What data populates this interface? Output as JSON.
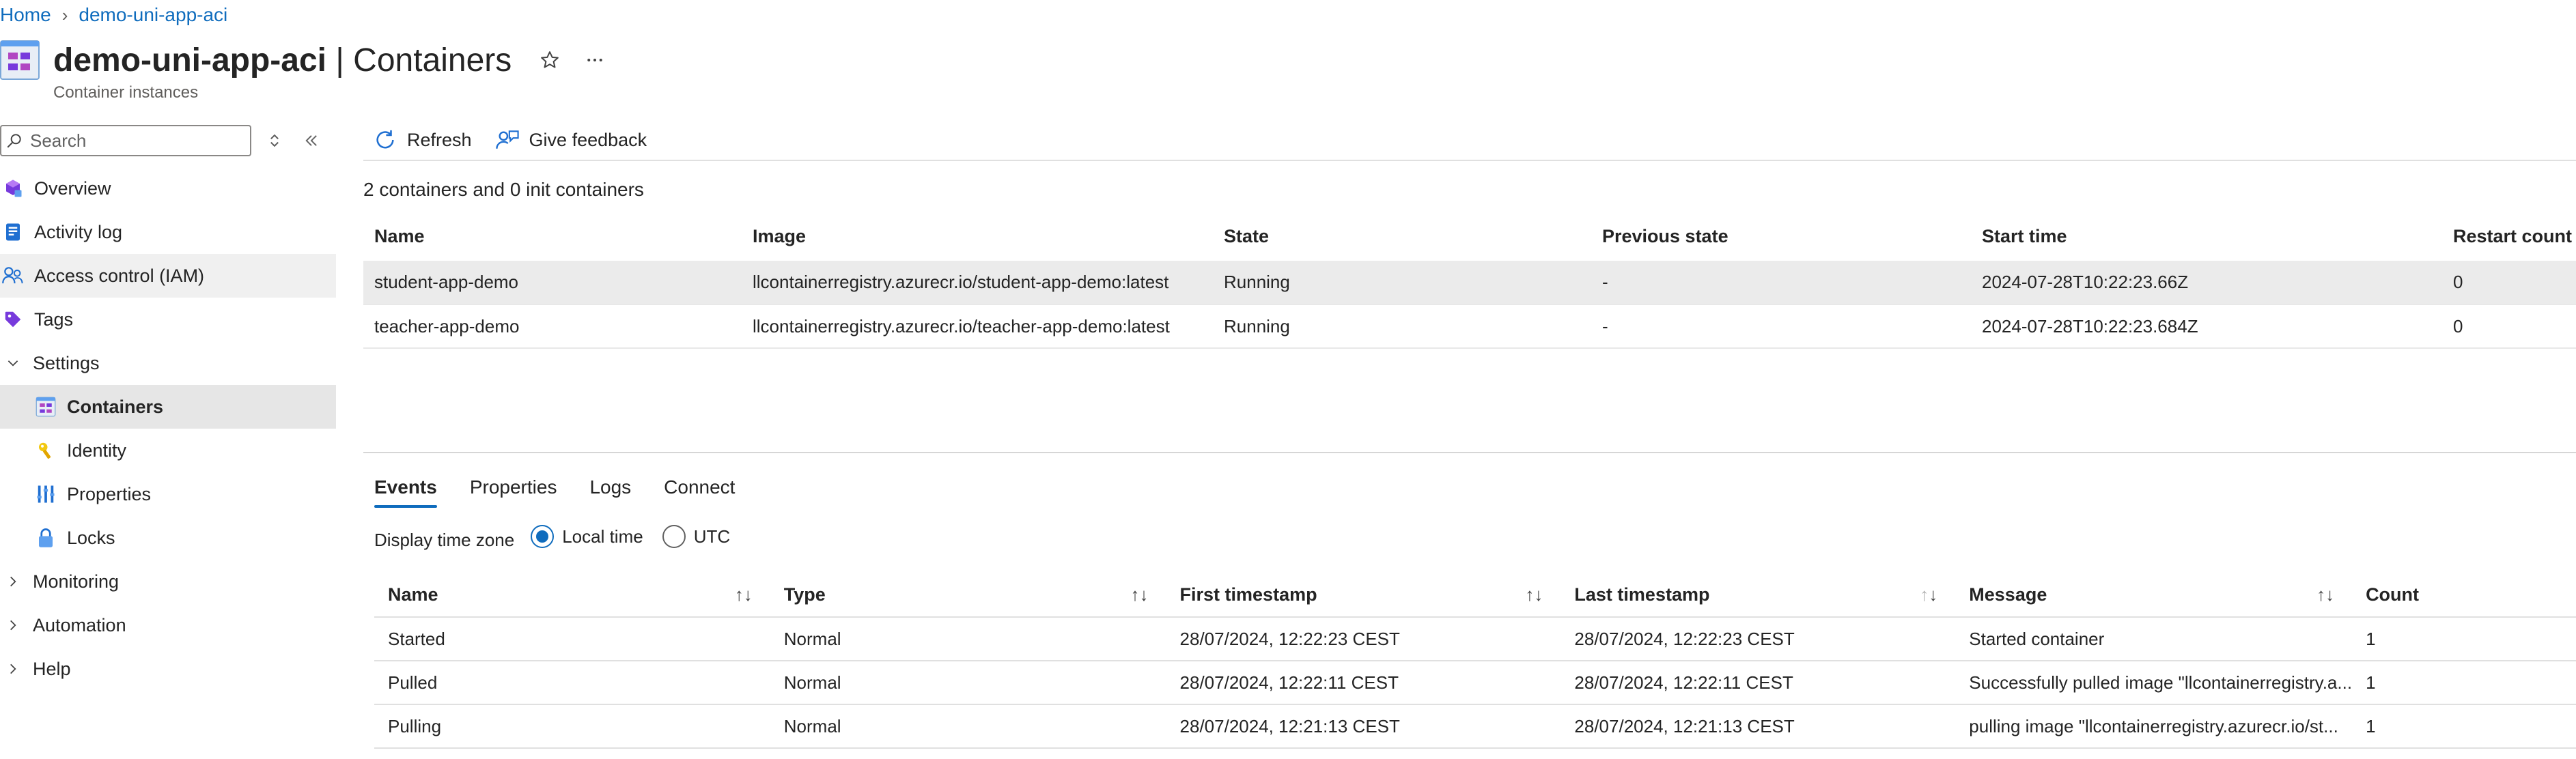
{
  "breadcrumb": {
    "home": "Home",
    "resource": "demo-uni-app-aci"
  },
  "header": {
    "resource_name": "demo-uni-app-aci",
    "section": " | Containers",
    "subtitle": "Container instances"
  },
  "sidebar": {
    "search_placeholder": "Search",
    "items": [
      {
        "label": "Overview",
        "icon": "cloud-icon"
      },
      {
        "label": "Activity log",
        "icon": "log-icon"
      },
      {
        "label": "Access control (IAM)",
        "icon": "people-icon"
      },
      {
        "label": "Tags",
        "icon": "tag-icon"
      },
      {
        "label": "Settings",
        "icon": "chevron-down-icon"
      },
      {
        "label": "Containers",
        "icon": "containers-icon"
      },
      {
        "label": "Identity",
        "icon": "key-icon"
      },
      {
        "label": "Properties",
        "icon": "properties-icon"
      },
      {
        "label": "Locks",
        "icon": "lock-icon"
      },
      {
        "label": "Monitoring",
        "icon": "chevron-right-icon"
      },
      {
        "label": "Automation",
        "icon": "chevron-right-icon"
      },
      {
        "label": "Help",
        "icon": "chevron-right-icon"
      }
    ]
  },
  "toolbar": {
    "refresh": "Refresh",
    "feedback": "Give feedback"
  },
  "containers": {
    "summary": "2 containers and 0 init containers",
    "columns": [
      "Name",
      "Image",
      "State",
      "Previous state",
      "Start time",
      "Restart count"
    ],
    "rows": [
      [
        "student-app-demo",
        "llcontainerregistry.azurecr.io/student-app-demo:latest",
        "Running",
        "-",
        "2024-07-28T10:22:23.66Z",
        "0"
      ],
      [
        "teacher-app-demo",
        "llcontainerregistry.azurecr.io/teacher-app-demo:latest",
        "Running",
        "-",
        "2024-07-28T10:22:23.684Z",
        "0"
      ]
    ]
  },
  "tabs": [
    "Events",
    "Properties",
    "Logs",
    "Connect"
  ],
  "timezone": {
    "label": "Display time zone",
    "local": "Local time",
    "utc": "UTC",
    "selected": "Local time"
  },
  "events": {
    "columns": [
      "Name",
      "Type",
      "First timestamp",
      "Last timestamp",
      "Message",
      "Count"
    ],
    "sort_glyph": "↑↓",
    "rows": [
      [
        "Started",
        "Normal",
        "28/07/2024, 12:22:23 CEST",
        "28/07/2024, 12:22:23 CEST",
        "Started container",
        "1"
      ],
      [
        "Pulled",
        "Normal",
        "28/07/2024, 12:22:11 CEST",
        "28/07/2024, 12:22:11 CEST",
        "Successfully pulled image \"llcontainerregistry.a...",
        "1"
      ],
      [
        "Pulling",
        "Normal",
        "28/07/2024, 12:21:13 CEST",
        "28/07/2024, 12:21:13 CEST",
        "pulling image \"llcontainerregistry.azurecr.io/st...",
        "1"
      ]
    ]
  },
  "colors": {
    "accent": "#0f6cbd",
    "selected_row": "#ebebeb",
    "active_nav": "#e6e6e6"
  }
}
